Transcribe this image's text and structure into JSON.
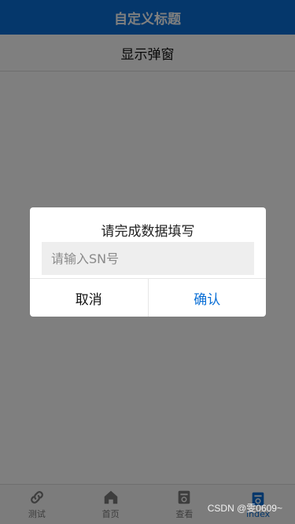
{
  "navbar": {
    "title": "自定义标题"
  },
  "page": {
    "show_popup_label": "显示弹窗"
  },
  "dialog": {
    "title": "请完成数据填写",
    "input_placeholder": "请输入SN号",
    "cancel_label": "取消",
    "confirm_label": "确认"
  },
  "tabbar": {
    "items": [
      {
        "label": "测试",
        "icon": "link-icon"
      },
      {
        "label": "首页",
        "icon": "home-icon"
      },
      {
        "label": "查看",
        "icon": "document-icon"
      },
      {
        "label": "index",
        "icon": "document-icon"
      }
    ]
  },
  "watermark": "CSDN @雯0609~",
  "colors": {
    "accent": "#0a6fd6",
    "mask": "rgba(0,0,0,0.5)"
  }
}
